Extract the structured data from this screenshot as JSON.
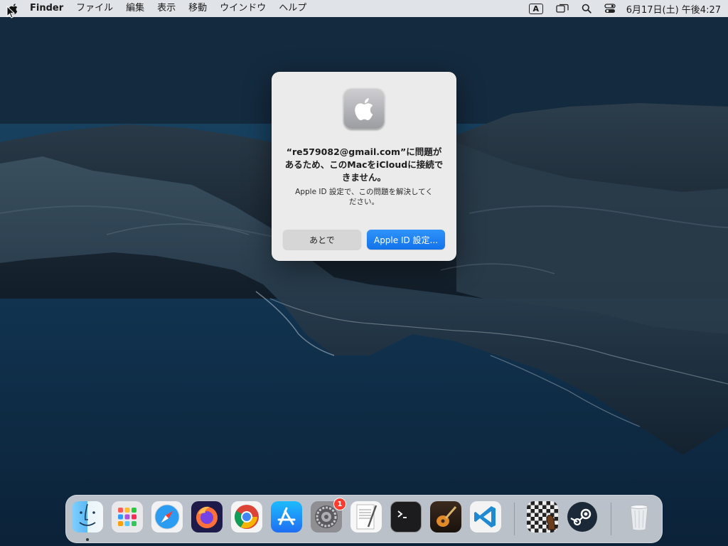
{
  "menubar": {
    "app_name": "Finder",
    "items": [
      "ファイル",
      "編集",
      "表示",
      "移動",
      "ウインドウ",
      "ヘルプ"
    ],
    "input_source": "A",
    "clock": "6月17日(土) 午後4:27"
  },
  "dialog": {
    "title": "“re579082@gmail.com”に問題があるため、このMacをiCloudに接続できません。",
    "message": "Apple ID 設定で、この問題を解決してください。",
    "later_button": "あとで",
    "settings_button": "Apple ID 設定..."
  },
  "dock": {
    "apps": [
      "finder-icon",
      "launchpad-icon",
      "safari-icon",
      "firefox-icon",
      "chrome-icon",
      "app-store-icon",
      "system-preferences-icon",
      "textedit-icon",
      "terminal-icon",
      "garageband-icon",
      "vscode-icon",
      "chess-icon",
      "steam-icon",
      "trash-icon"
    ],
    "system_preferences_badge": "1"
  },
  "colors": {
    "accent": "#1a7ff0",
    "badge": "#ff3b30"
  }
}
